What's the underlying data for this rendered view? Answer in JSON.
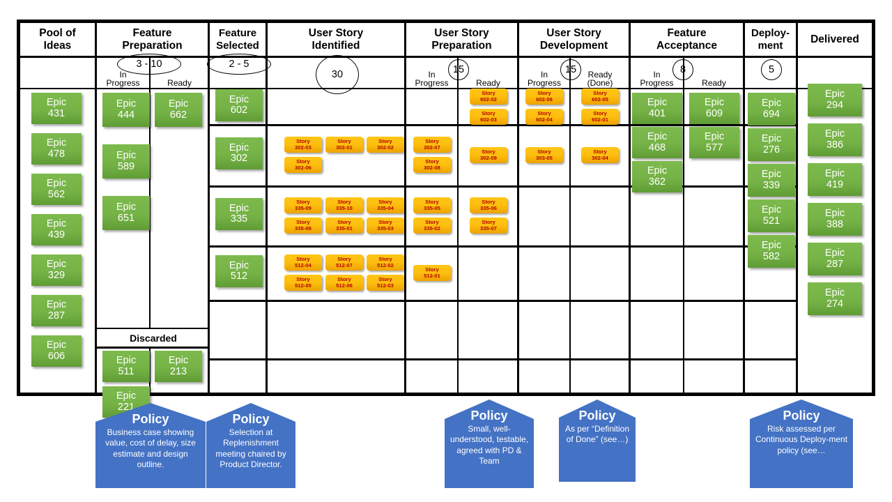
{
  "board": {
    "columns": [
      {
        "id": "pool-of-ideas",
        "title": "Pool of\nIdeas",
        "wip": null,
        "sub": []
      },
      {
        "id": "feature-preparation",
        "title": "Feature\nPreparation",
        "wip": "3 - 10",
        "sub": [
          "In\nProgress",
          "Ready"
        ]
      },
      {
        "id": "feature-selected",
        "title": "Feature\nSelected",
        "wip": "2 - 5",
        "sub": []
      },
      {
        "id": "user-story-identified",
        "title": "User Story\nIdentified",
        "wip": "30",
        "sub": []
      },
      {
        "id": "user-story-preparation",
        "title": "User Story\nPreparation",
        "wip": "15",
        "sub": [
          "In\nProgress",
          "Ready"
        ]
      },
      {
        "id": "user-story-development",
        "title": "User Story\nDevelopment",
        "wip": "15",
        "sub": [
          "In\nProgress",
          "Ready\n(Done)"
        ]
      },
      {
        "id": "feature-acceptance",
        "title": "Feature\nAcceptance",
        "wip": "8",
        "sub": [
          "In\nProgress",
          "Ready"
        ]
      },
      {
        "id": "deployment",
        "title": "Deploy-\nment",
        "wip": "5",
        "sub": []
      },
      {
        "id": "delivered",
        "title": "Delivered",
        "wip": null,
        "sub": []
      }
    ],
    "discarded_label": "Discarded",
    "colors": {
      "epic": "#76b347",
      "story": "#ffc000",
      "story_text": "#b30000",
      "policy": "#4472c4",
      "border": "#000000"
    }
  },
  "pool_of_ideas": {
    "cards": [
      "Epic\n431",
      "Epic\n478",
      "Epic\n562",
      "Epic\n439",
      "Epic\n329",
      "Epic\n287",
      "Epic\n606"
    ]
  },
  "feature_preparation": {
    "in_progress": [
      "Epic\n444",
      "Epic\n589",
      "Epic\n651"
    ],
    "ready": [
      "Epic\n662"
    ],
    "discarded_in_progress": [
      "Epic\n511",
      "Epic\n221"
    ],
    "discarded_ready": [
      "Epic\n213"
    ]
  },
  "feature_selected": {
    "lanes": [
      "Epic\n602",
      "Epic\n302",
      "Epic\n335",
      "Epic\n512",
      ""
    ]
  },
  "user_story_identified": {
    "lanes": [
      [],
      [
        "Story\n302-03",
        "Story\n302-01",
        "Story\n302-02",
        "Story\n302-06"
      ],
      [
        "Story\n335-09",
        "Story\n335-10",
        "Story\n335-04",
        "Story\n335-08",
        "Story\n335-01",
        "Story\n335-03"
      ],
      [
        "Story\n512-04",
        "Story\n512-07",
        "Story\n512-02",
        "Story\n512-05",
        "Story\n512-06",
        "Story\n512-03"
      ],
      []
    ]
  },
  "user_story_preparation": {
    "in_progress_lanes": [
      [],
      [
        "Story\n302-07",
        "Story\n302-08"
      ],
      [
        "Story\n335-05",
        "Story\n335-02"
      ],
      [
        "Story\n512-01"
      ],
      []
    ],
    "ready_lanes": [
      [
        "Story\n602-02",
        "Story\n602-03"
      ],
      [
        "Story\n302-09"
      ],
      [
        "Story\n335-06",
        "Story\n335-07"
      ],
      [],
      []
    ]
  },
  "user_story_development": {
    "in_progress_lanes": [
      [
        "Story\n602-06",
        "Story\n602-04"
      ],
      [
        "Story\n303-05"
      ],
      [],
      [],
      []
    ],
    "ready_done_lanes": [
      [
        "Story\n602-05",
        "Story\n602-01"
      ],
      [
        "Story\n302-04"
      ],
      [],
      [],
      []
    ]
  },
  "feature_acceptance": {
    "in_progress": [
      "Epic\n401",
      "Epic\n468",
      "Epic\n362"
    ],
    "ready": [
      "Epic\n609",
      "Epic\n577"
    ]
  },
  "deployment": {
    "cards": [
      "Epic\n694",
      "Epic\n276",
      "Epic\n339",
      "Epic\n521",
      "Epic\n582"
    ]
  },
  "delivered": {
    "cards": [
      "Epic\n294",
      "Epic\n386",
      "Epic\n419",
      "Epic\n388",
      "Epic\n287",
      "Epic\n274"
    ]
  },
  "policies": [
    {
      "id": "policy-feature-preparation",
      "title": "Policy",
      "body": "Business case showing value, cost of delay, size estimate and design outline."
    },
    {
      "id": "policy-feature-selected",
      "title": "Policy",
      "body": "Selection at Replenishment meeting chaired by Product Director."
    },
    {
      "id": "policy-user-story-preparation",
      "title": "Policy",
      "body": "Small, well-understood, testable, agreed with PD & Team"
    },
    {
      "id": "policy-user-story-development",
      "title": "Policy",
      "body": "As per “Definition of Done” (see…)"
    },
    {
      "id": "policy-deployment",
      "title": "Policy",
      "body": "Risk assessed per Continuous Deploy-ment policy (see…"
    }
  ]
}
